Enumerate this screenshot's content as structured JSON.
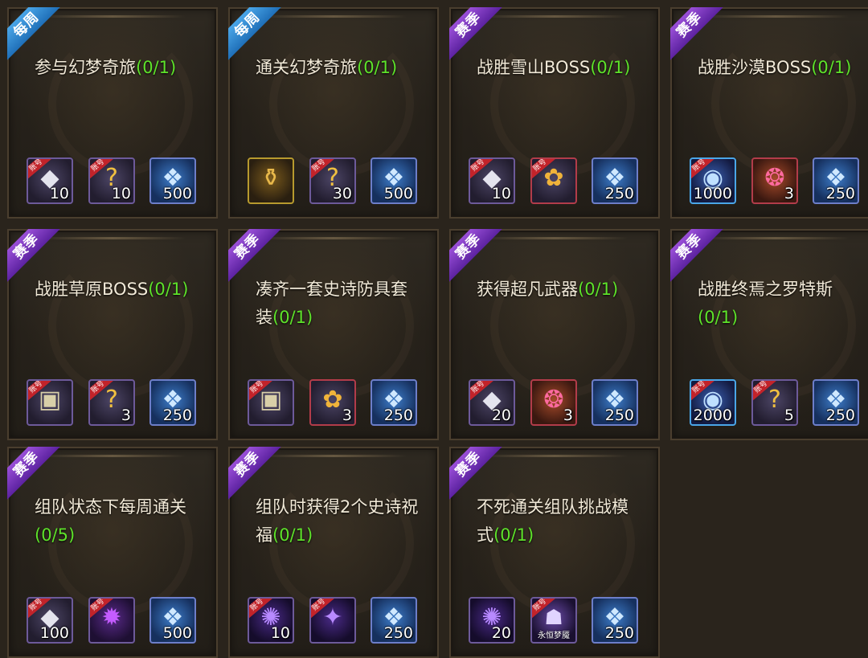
{
  "labels": {
    "weekly": "每周",
    "season": "赛季",
    "bind": "账号"
  },
  "cards": [
    {
      "tag": "weekly",
      "title": "参与幻梦奇旅",
      "progress": "(0/1)",
      "rewards": [
        {
          "icon": "diamond",
          "qty": "10",
          "bound": true
        },
        {
          "icon": "question",
          "qty": "10",
          "bound": true
        },
        {
          "icon": "crystal",
          "qty": "500",
          "bound": false
        }
      ]
    },
    {
      "tag": "weekly",
      "title": "通关幻梦奇旅",
      "progress": "(0/1)",
      "rewards": [
        {
          "icon": "urn",
          "qty": "",
          "bound": false
        },
        {
          "icon": "question",
          "qty": "30",
          "bound": true
        },
        {
          "icon": "crystal",
          "qty": "500",
          "bound": false
        }
      ]
    },
    {
      "tag": "season",
      "title": "战胜雪山BOSS",
      "progress": "(0/1)",
      "rewards": [
        {
          "icon": "diamond",
          "qty": "10",
          "bound": true
        },
        {
          "icon": "scroll",
          "qty": "",
          "bound": true
        },
        {
          "icon": "crystal",
          "qty": "250",
          "bound": false
        }
      ]
    },
    {
      "tag": "season",
      "title": "战胜沙漠BOSS",
      "progress": "(0/1)",
      "rewards": [
        {
          "icon": "orb",
          "qty": "1000",
          "bound": true
        },
        {
          "icon": "gem",
          "qty": "3",
          "bound": false
        },
        {
          "icon": "crystal",
          "qty": "250",
          "bound": false
        }
      ]
    },
    {
      "tag": "season",
      "title": "战胜草原BOSS",
      "progress": "(0/1)",
      "rewards": [
        {
          "icon": "box",
          "qty": "",
          "bound": true
        },
        {
          "icon": "question",
          "qty": "3",
          "bound": true
        },
        {
          "icon": "crystal",
          "qty": "250",
          "bound": false
        }
      ]
    },
    {
      "tag": "season",
      "title": "凑齐一套史诗防具套装",
      "progress": "(0/1)",
      "rewards": [
        {
          "icon": "box",
          "qty": "",
          "bound": true
        },
        {
          "icon": "scroll",
          "qty": "3",
          "bound": false
        },
        {
          "icon": "crystal",
          "qty": "250",
          "bound": false
        }
      ]
    },
    {
      "tag": "season",
      "title": "获得超凡武器",
      "progress": "(0/1)",
      "rewards": [
        {
          "icon": "diamond",
          "qty": "20",
          "bound": true
        },
        {
          "icon": "gem",
          "qty": "3",
          "bound": false
        },
        {
          "icon": "crystal",
          "qty": "250",
          "bound": false
        }
      ]
    },
    {
      "tag": "season",
      "title": "战胜终焉之罗特斯",
      "progress": "(0/1)",
      "rewards": [
        {
          "icon": "orb",
          "qty": "2000",
          "bound": true
        },
        {
          "icon": "question",
          "qty": "5",
          "bound": true
        },
        {
          "icon": "crystal",
          "qty": "250",
          "bound": false
        }
      ]
    },
    {
      "tag": "season",
      "title": "组队状态下每周通关",
      "progress": "(0/5)",
      "rewards": [
        {
          "icon": "diamond",
          "qty": "100",
          "bound": true
        },
        {
          "icon": "creature",
          "qty": "",
          "bound": true
        },
        {
          "icon": "crystal",
          "qty": "500",
          "bound": false
        }
      ]
    },
    {
      "tag": "season",
      "title": "组队时获得2个史诗祝福",
      "progress": "(0/1)",
      "rewards": [
        {
          "icon": "swirl",
          "qty": "10",
          "bound": true
        },
        {
          "icon": "swirl",
          "qty": "",
          "bound": true
        },
        {
          "icon": "crystal",
          "qty": "250",
          "bound": false
        }
      ]
    },
    {
      "tag": "season",
      "title": "不死通关组队挑战模式",
      "progress": "(0/1)",
      "rewards": [
        {
          "icon": "swirl",
          "qty": "20",
          "bound": false
        },
        {
          "icon": "mask",
          "qty": "",
          "bound": true,
          "subtext": "永恒梦魇"
        },
        {
          "icon": "crystal",
          "qty": "250",
          "bound": false
        }
      ]
    }
  ]
}
